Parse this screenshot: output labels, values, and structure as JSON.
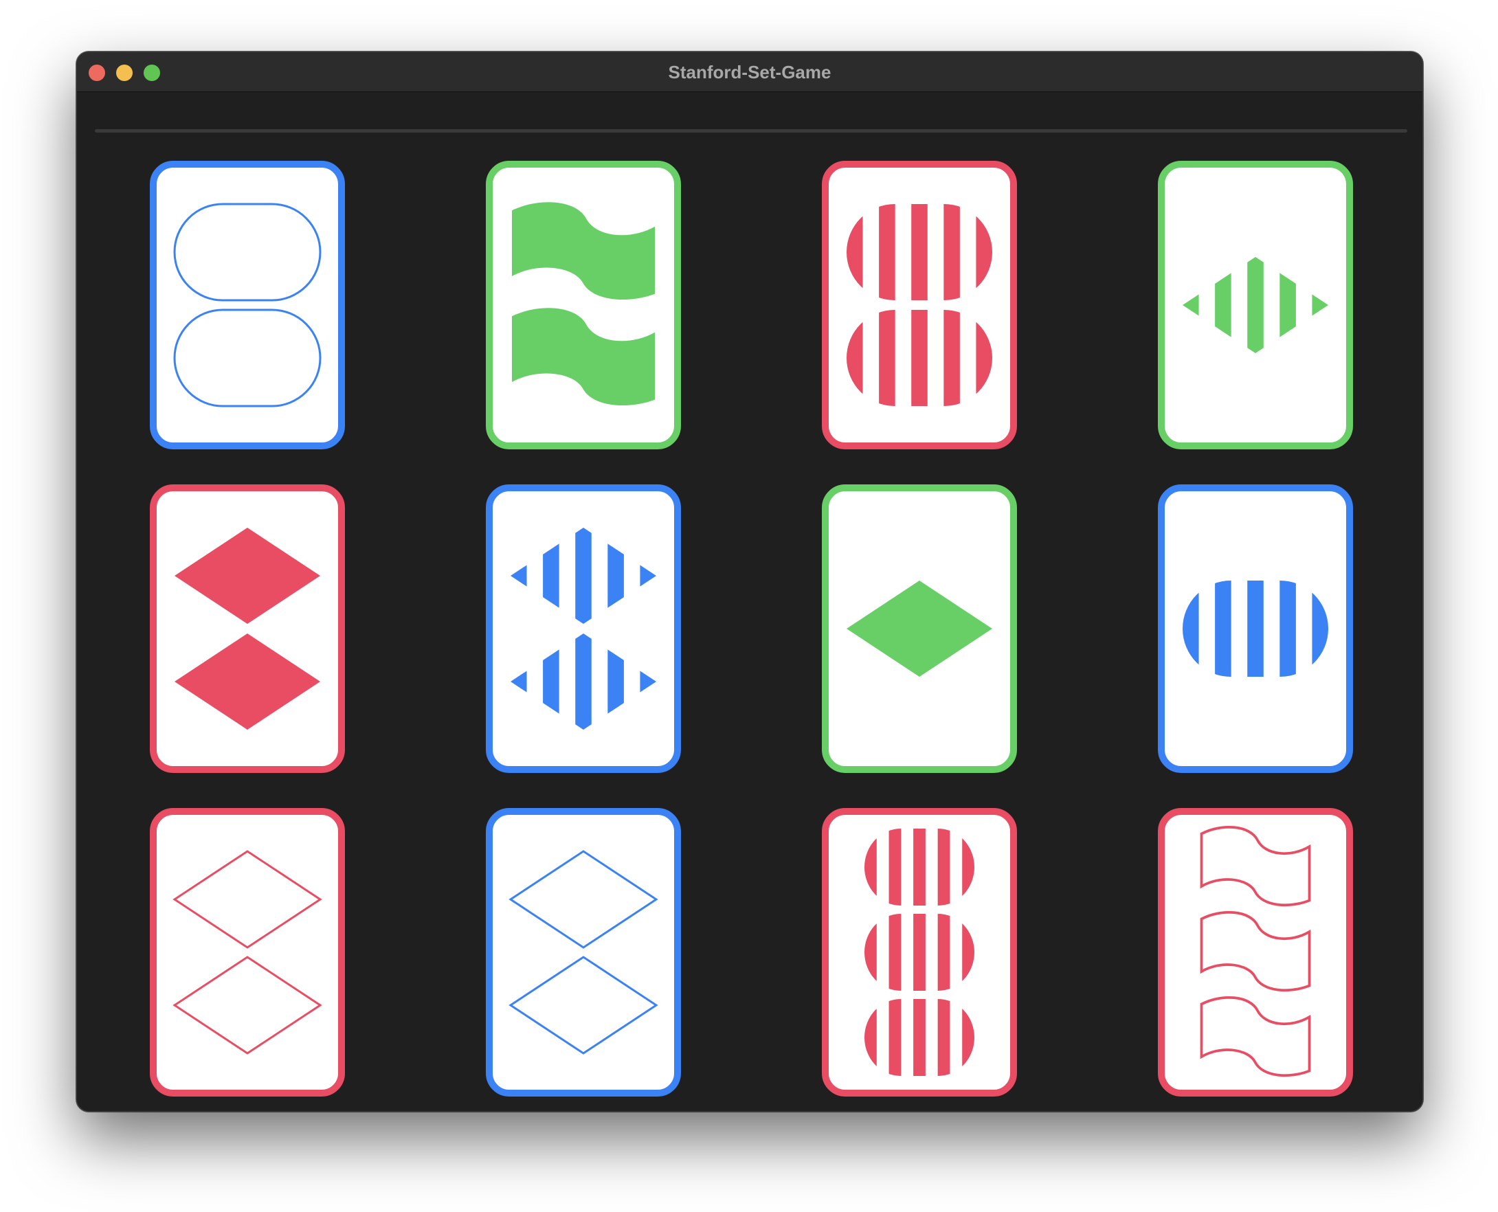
{
  "window": {
    "title": "Stanford-Set-Game",
    "traffic_lights": [
      {
        "name": "close",
        "color": "#ed6a5e"
      },
      {
        "name": "minimize",
        "color": "#f5bf4f"
      },
      {
        "name": "zoom",
        "color": "#61c554"
      }
    ]
  },
  "colors": {
    "red": "#e84d63",
    "green": "#68cf67",
    "blue": "#3b82f4",
    "background": "#1f1f1f",
    "card_face": "#ffffff"
  },
  "cards": [
    {
      "shape": "oval",
      "count": 2,
      "shading": "open",
      "color": "blue"
    },
    {
      "shape": "squiggle",
      "count": 2,
      "shading": "solid",
      "color": "green"
    },
    {
      "shape": "oval",
      "count": 2,
      "shading": "striped",
      "color": "red"
    },
    {
      "shape": "diamond",
      "count": 1,
      "shading": "striped",
      "color": "green"
    },
    {
      "shape": "diamond",
      "count": 2,
      "shading": "solid",
      "color": "red"
    },
    {
      "shape": "diamond",
      "count": 2,
      "shading": "striped",
      "color": "blue"
    },
    {
      "shape": "diamond",
      "count": 1,
      "shading": "solid",
      "color": "green"
    },
    {
      "shape": "oval",
      "count": 1,
      "shading": "striped",
      "color": "blue"
    },
    {
      "shape": "diamond",
      "count": 2,
      "shading": "open",
      "color": "red"
    },
    {
      "shape": "diamond",
      "count": 2,
      "shading": "open",
      "color": "blue"
    },
    {
      "shape": "oval",
      "count": 3,
      "shading": "striped",
      "color": "red"
    },
    {
      "shape": "squiggle",
      "count": 3,
      "shading": "open",
      "color": "red"
    }
  ]
}
